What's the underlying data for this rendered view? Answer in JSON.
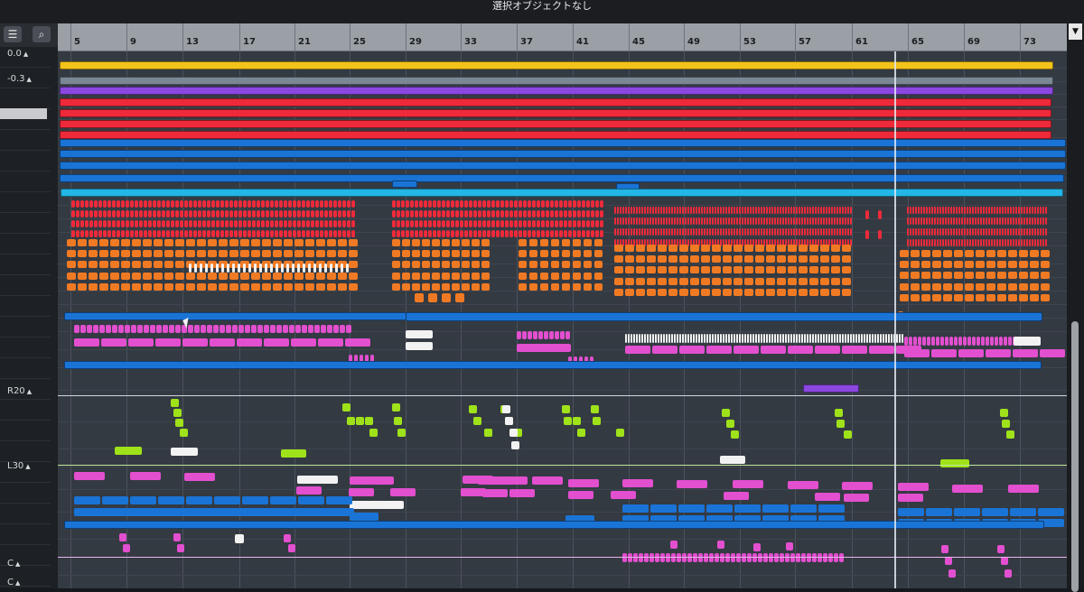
{
  "title": "選択オブジェクトなし",
  "toolbar": {
    "list_icon": "☰",
    "search_icon": "⌕"
  },
  "left_values": [
    "0.0",
    "-0.3",
    "R20",
    "L30",
    "C",
    "C"
  ],
  "ruler": {
    "labels": [
      "5",
      "9",
      "13",
      "17",
      "21",
      "25",
      "29",
      "33",
      "37",
      "41",
      "45",
      "49",
      "53",
      "57",
      "61",
      "65",
      "69",
      "73"
    ]
  },
  "colors": {
    "yellow": "#f2c31b",
    "purple": "#8b47e0",
    "red": "#ee2a3a",
    "blue": "#1a74d6",
    "cyan": "#23b6e6",
    "orange": "#f07a23",
    "pink": "#e24fcf",
    "lime": "#9fe21a",
    "white": "#f2f2f2"
  }
}
